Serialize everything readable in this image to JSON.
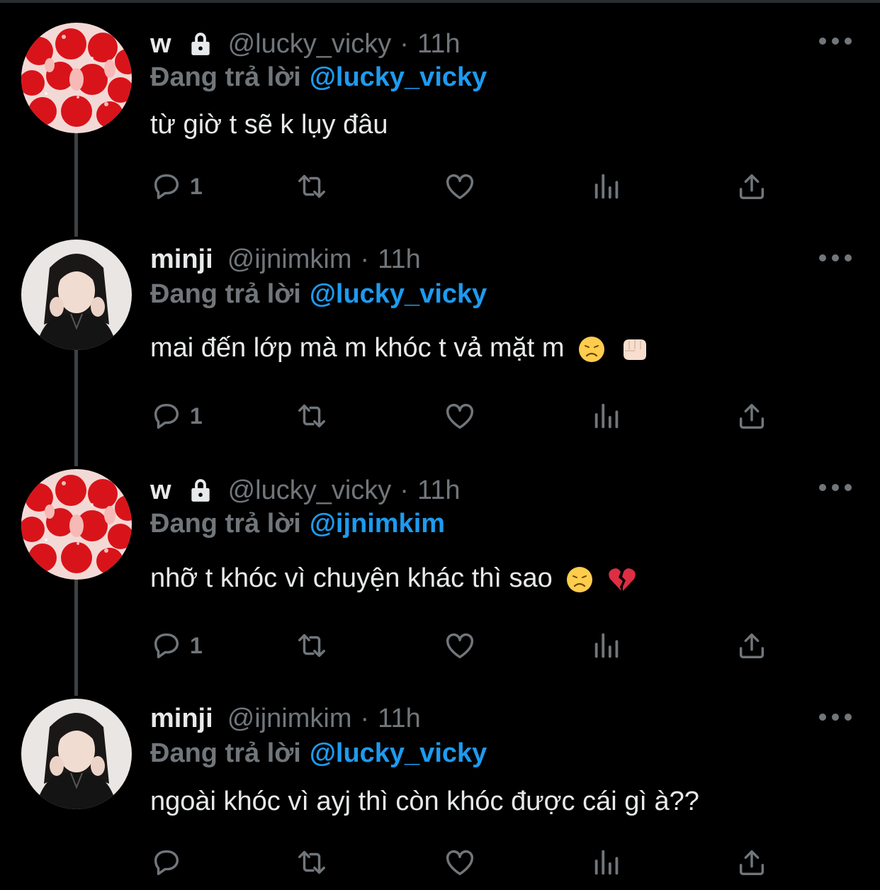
{
  "colors": {
    "background": "#000000",
    "text": "#e7e9ea",
    "muted": "#71767b",
    "accent": "#1d9bf0"
  },
  "tweets": [
    {
      "name": "w",
      "locked": true,
      "handle": "@lucky_vicky",
      "dot": "·",
      "time": "11h",
      "reply_prefix": "Đang trả lời",
      "reply_to": "@lucky_vicky",
      "text": "từ giờ t sẽ k lụy đâu",
      "emojis": [],
      "reply_count": "1",
      "avatar": "strawberries-avatar"
    },
    {
      "name": "minji",
      "locked": false,
      "handle": "@ijnimkim",
      "dot": "·",
      "time": "11h",
      "reply_prefix": "Đang trả lời",
      "reply_to": "@lucky_vicky",
      "text": "mai đến lớp mà m khóc t vả mặt m",
      "emojis": [
        "disappointed-face-emoji",
        "oncoming-fist-emoji"
      ],
      "reply_count": "1",
      "avatar": "girl-portrait-avatar"
    },
    {
      "name": "w",
      "locked": true,
      "handle": "@lucky_vicky",
      "dot": "·",
      "time": "11h",
      "reply_prefix": "Đang trả lời",
      "reply_to": "@ijnimkim",
      "text": "nhỡ t khóc vì chuyện khác thì sao",
      "emojis": [
        "disappointed-face-emoji",
        "broken-heart-emoji"
      ],
      "reply_count": "1",
      "avatar": "strawberries-avatar"
    },
    {
      "name": "minji",
      "locked": false,
      "handle": "@ijnimkim",
      "dot": "·",
      "time": "11h",
      "reply_prefix": "Đang trả lời",
      "reply_to": "@lucky_vicky",
      "text": "ngoài khóc vì ayj thì còn khóc được cái gì à??",
      "emojis": [],
      "reply_count": "",
      "avatar": "girl-portrait-avatar"
    }
  ]
}
